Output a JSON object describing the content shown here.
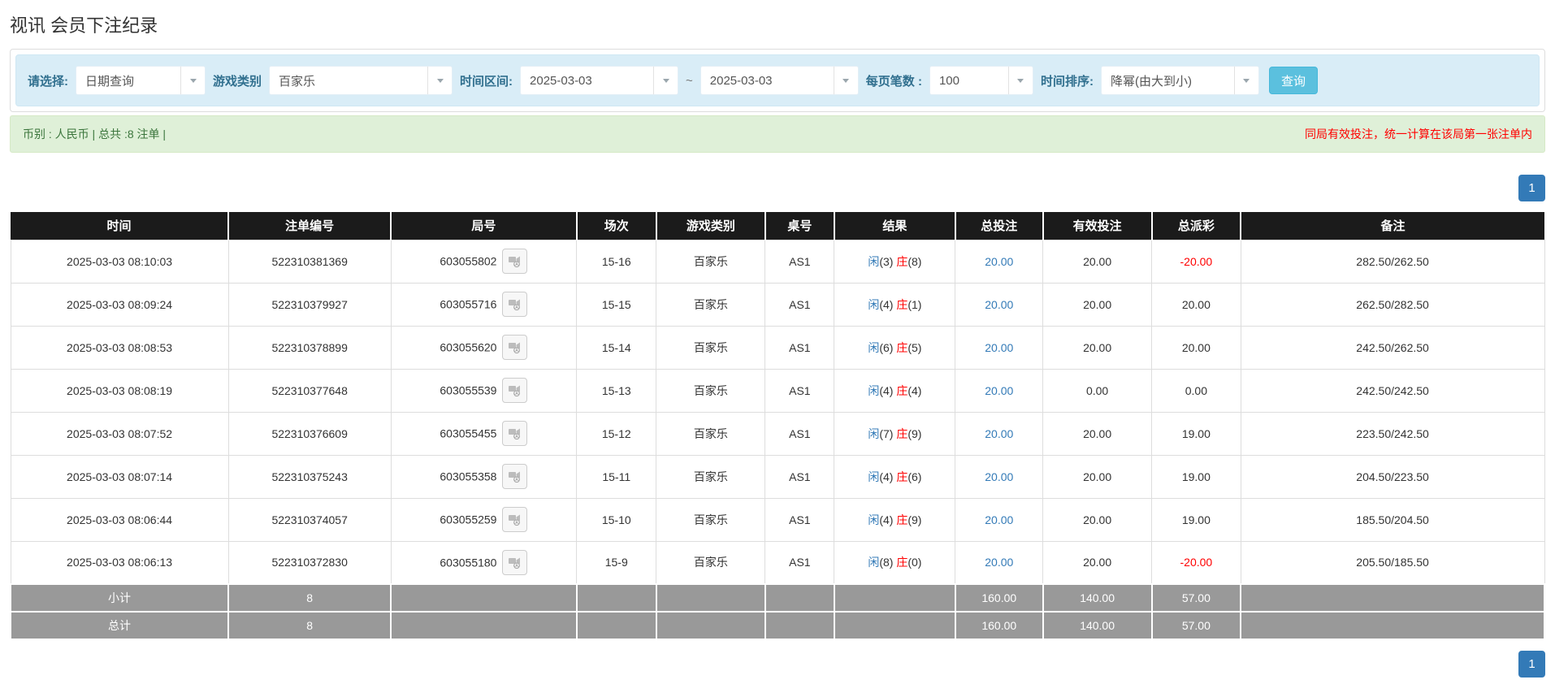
{
  "page": {
    "title": "视讯 会员下注纪录"
  },
  "filters": {
    "select_label": "请选择:",
    "query_type": "日期查询",
    "game_category_label": "游戏类别",
    "game_category": "百家乐",
    "time_range_label": "时间区间:",
    "date_from": "2025-03-03",
    "tilde": "~",
    "date_to": "2025-03-03",
    "page_size_label": "每页笔数 :",
    "page_size": "100",
    "sort_label": "时间排序:",
    "sort_order": "降幂(由大到小)",
    "search_button": "查询"
  },
  "summary": {
    "left": "币别 : 人民币 | 总共 :8 注单 |",
    "right": "同局有效投注，统一计算在该局第一张注单内"
  },
  "pagination": {
    "page": "1"
  },
  "icons": {
    "select_caret": "chevron-down-icon",
    "round_media": "video-camera-icon"
  },
  "colors": {
    "header_bg": "#1b1b1b",
    "footer_bg": "#999999",
    "link_blue": "#337ab7",
    "player_blue": "#337ab7",
    "banker_red": "#ff0000",
    "negative_red": "#ff0000",
    "filter_bg": "#d9edf7",
    "filter_label": "#31708f",
    "summary_bg": "#dff0d8",
    "summary_text": "#3c763d",
    "search_button_bg": "#5bc0de",
    "pager_bg": "#337ab7"
  },
  "table": {
    "headers": [
      "时间",
      "注单编号",
      "局号",
      "场次",
      "游戏类别",
      "桌号",
      "结果",
      "总投注",
      "有效投注",
      "总派彩",
      "备注"
    ],
    "result_labels": {
      "player": "闲",
      "banker": "庄"
    },
    "rows": [
      {
        "time": "2025-03-03 08:10:03",
        "bet_id": "522310381369",
        "round_id": "603055802",
        "session": "15-16",
        "game": "百家乐",
        "table_no": "AS1",
        "result": {
          "player": "3",
          "banker": "8"
        },
        "total_bet": "20.00",
        "valid_bet": "20.00",
        "payout": "-20.00",
        "remark": "282.50/262.50"
      },
      {
        "time": "2025-03-03 08:09:24",
        "bet_id": "522310379927",
        "round_id": "603055716",
        "session": "15-15",
        "game": "百家乐",
        "table_no": "AS1",
        "result": {
          "player": "4",
          "banker": "1"
        },
        "total_bet": "20.00",
        "valid_bet": "20.00",
        "payout": "20.00",
        "remark": "262.50/282.50"
      },
      {
        "time": "2025-03-03 08:08:53",
        "bet_id": "522310378899",
        "round_id": "603055620",
        "session": "15-14",
        "game": "百家乐",
        "table_no": "AS1",
        "result": {
          "player": "6",
          "banker": "5"
        },
        "total_bet": "20.00",
        "valid_bet": "20.00",
        "payout": "20.00",
        "remark": "242.50/262.50"
      },
      {
        "time": "2025-03-03 08:08:19",
        "bet_id": "522310377648",
        "round_id": "603055539",
        "session": "15-13",
        "game": "百家乐",
        "table_no": "AS1",
        "result": {
          "player": "4",
          "banker": "4"
        },
        "total_bet": "20.00",
        "valid_bet": "0.00",
        "payout": "0.00",
        "remark": "242.50/242.50"
      },
      {
        "time": "2025-03-03 08:07:52",
        "bet_id": "522310376609",
        "round_id": "603055455",
        "session": "15-12",
        "game": "百家乐",
        "table_no": "AS1",
        "result": {
          "player": "7",
          "banker": "9"
        },
        "total_bet": "20.00",
        "valid_bet": "20.00",
        "payout": "19.00",
        "remark": "223.50/242.50"
      },
      {
        "time": "2025-03-03 08:07:14",
        "bet_id": "522310375243",
        "round_id": "603055358",
        "session": "15-11",
        "game": "百家乐",
        "table_no": "AS1",
        "result": {
          "player": "4",
          "banker": "6"
        },
        "total_bet": "20.00",
        "valid_bet": "20.00",
        "payout": "19.00",
        "remark": "204.50/223.50"
      },
      {
        "time": "2025-03-03 08:06:44",
        "bet_id": "522310374057",
        "round_id": "603055259",
        "session": "15-10",
        "game": "百家乐",
        "table_no": "AS1",
        "result": {
          "player": "4",
          "banker": "9"
        },
        "total_bet": "20.00",
        "valid_bet": "20.00",
        "payout": "19.00",
        "remark": "185.50/204.50"
      },
      {
        "time": "2025-03-03 08:06:13",
        "bet_id": "522310372830",
        "round_id": "603055180",
        "session": "15-9",
        "game": "百家乐",
        "table_no": "AS1",
        "result": {
          "player": "8",
          "banker": "0"
        },
        "total_bet": "20.00",
        "valid_bet": "20.00",
        "payout": "-20.00",
        "remark": "205.50/185.50"
      }
    ],
    "subtotal": {
      "label": "小计",
      "count": "8",
      "total_bet": "160.00",
      "valid_bet": "140.00",
      "payout": "57.00"
    },
    "total": {
      "label": "总计",
      "count": "8",
      "total_bet": "160.00",
      "valid_bet": "140.00",
      "payout": "57.00"
    }
  }
}
